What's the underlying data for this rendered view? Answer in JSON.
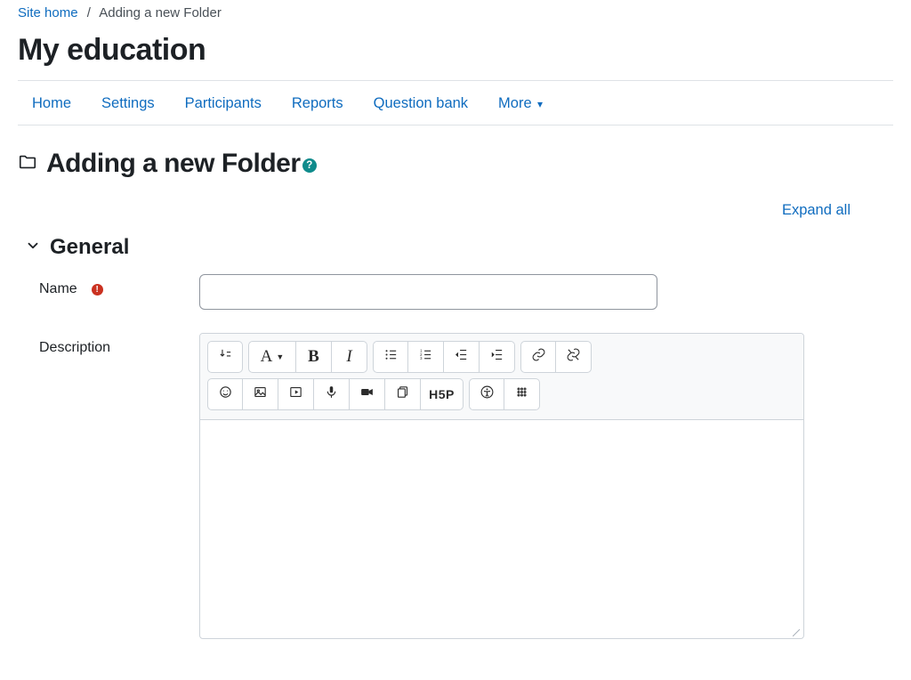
{
  "breadcrumb": {
    "home_label": "Site home",
    "current": "Adding a new Folder"
  },
  "page_title": "My education",
  "tabs": {
    "home": "Home",
    "settings": "Settings",
    "participants": "Participants",
    "reports": "Reports",
    "question_bank": "Question bank",
    "more": "More"
  },
  "section": {
    "title": "Adding a new Folder",
    "help_label": "?"
  },
  "expand_all": "Expand all",
  "fieldset": {
    "general": "General"
  },
  "form": {
    "name_label": "Name",
    "name_value": "",
    "required_label": "!",
    "description_label": "Description",
    "description_value": ""
  },
  "editor_toolbar": {
    "paragraph_label": "A",
    "bold_label": "B",
    "italic_label": "I",
    "h5p_label": "H5P"
  }
}
